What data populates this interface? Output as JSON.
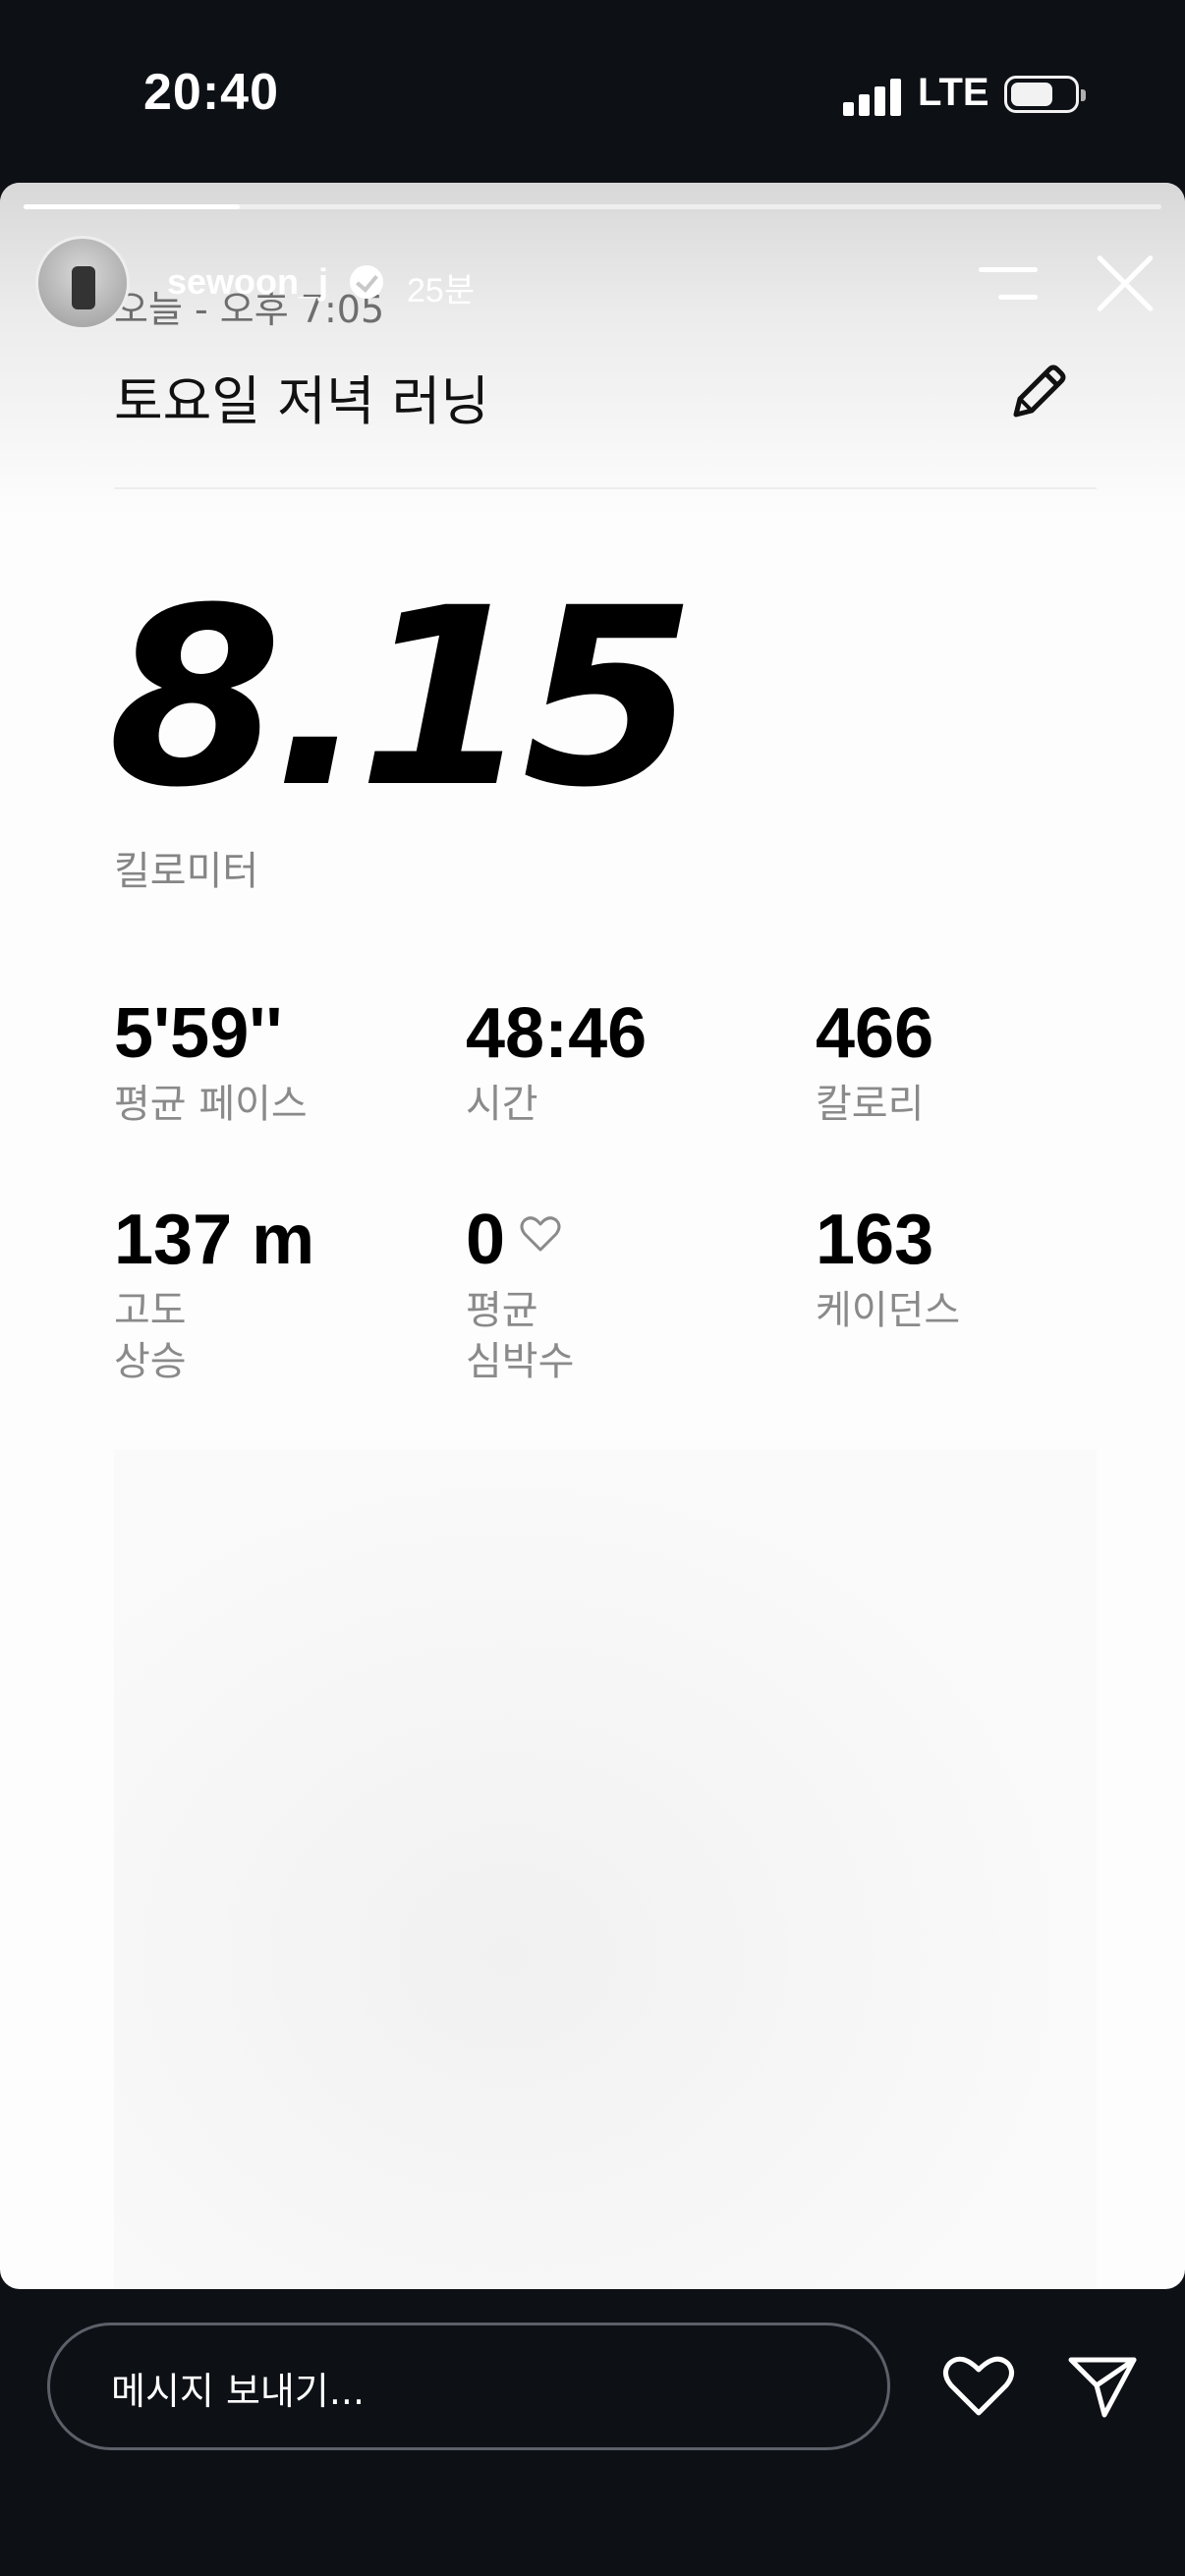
{
  "status_bar": {
    "time": "20:40",
    "network": "LTE",
    "icons": [
      "signal-icon",
      "battery-icon"
    ]
  },
  "story": {
    "progress": 0.19,
    "username": "sewoon_j",
    "verified": true,
    "posted_ago": "25분",
    "icons": [
      "menu-icon",
      "close-icon"
    ]
  },
  "activity": {
    "date_line": "오늘 - 오후 7:05",
    "title": "토요일 저녁 러닝",
    "edit_icon": "pencil-icon",
    "distance": "8.15",
    "distance_unit": "킬로미터",
    "stats": [
      {
        "value": "5'59''",
        "label": "평균 페이스"
      },
      {
        "value": "48:46",
        "label": "시간"
      },
      {
        "value": "466",
        "label": "칼로리"
      },
      {
        "value": "137 m",
        "label": "고도\n상승"
      },
      {
        "value": "0",
        "label": "평균\n심박수",
        "icon": "heart-outline-icon"
      },
      {
        "value": "163",
        "label": "케이던스"
      }
    ]
  },
  "reply_bar": {
    "placeholder": "메시지 보내기...",
    "icons": [
      "heart-icon",
      "send-icon"
    ]
  },
  "colors": {
    "background": "#0d1015",
    "card": "#fdfdfd",
    "label_gray": "#8a8a8a"
  }
}
